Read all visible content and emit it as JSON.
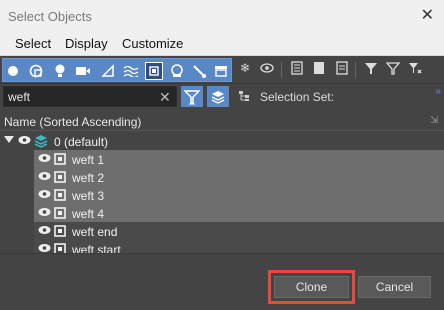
{
  "window": {
    "title": "Select Objects",
    "close_glyph": "✕"
  },
  "menu": {
    "items": [
      "Select",
      "Display",
      "Customize"
    ]
  },
  "toolbar": {
    "icons": [
      "geometry-icon",
      "shapes-icon",
      "lights-icon",
      "cameras-icon",
      "helpers-icon",
      "spacewarps-icon",
      "groups-icon",
      "xrefs-icon",
      "bones-icon",
      "containers-icon",
      "frozen-icon",
      "hidden-icon",
      "display-icon",
      "select-all-icon",
      "select-none-icon",
      "select-invert-icon",
      "filter-icon",
      "find-filter-icon",
      "sort-icon"
    ]
  },
  "filter": {
    "search_value": "weft",
    "clear_glyph": "✕",
    "selection_set_label": "Selection Set:"
  },
  "tree": {
    "column_header": "Name (Sorted Ascending)",
    "layer": {
      "name": "0 (default)"
    },
    "items": [
      {
        "name": "weft 1",
        "selected": true
      },
      {
        "name": "weft 2",
        "selected": true
      },
      {
        "name": "weft 3",
        "selected": true
      },
      {
        "name": "weft 4",
        "selected": true
      },
      {
        "name": "weft end",
        "selected": false
      },
      {
        "name": "weft start",
        "selected": false
      }
    ]
  },
  "buttons": {
    "clone": "Clone",
    "cancel": "Cancel"
  },
  "colors": {
    "accent": "#5a87c6",
    "selected_row": "#6e6e6e",
    "highlight_box": "#e8493a",
    "background": "#444444"
  }
}
